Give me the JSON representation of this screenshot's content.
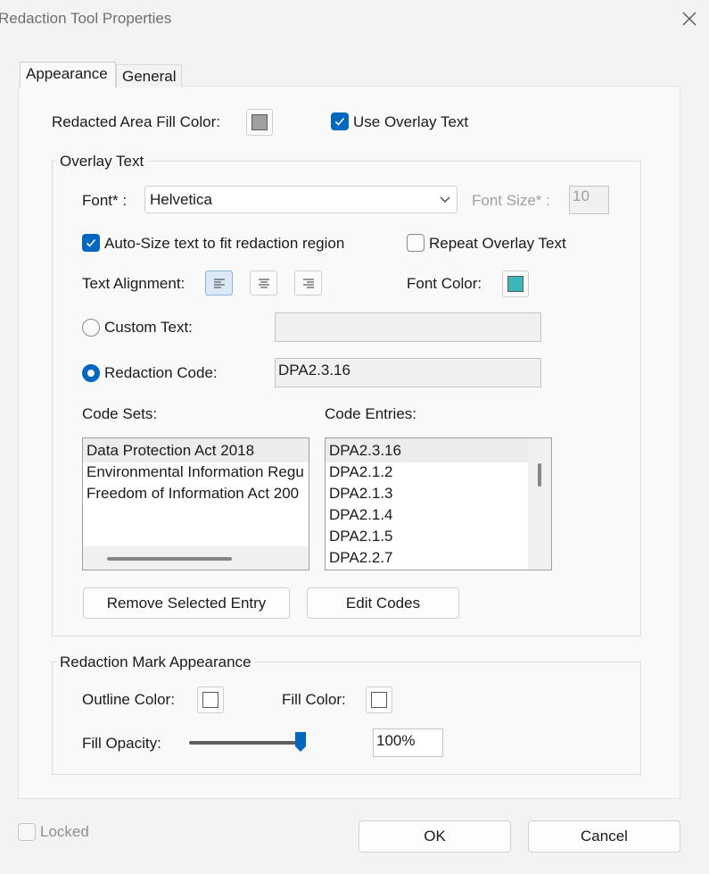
{
  "window": {
    "title": "Redaction Tool Properties"
  },
  "tabs": [
    {
      "label": "Appearance"
    },
    {
      "label": "General"
    }
  ],
  "appearance": {
    "fill_color_label": "Redacted Area Fill Color:",
    "fill_color": "#a0a0a0",
    "use_overlay_label": "Use Overlay Text",
    "use_overlay_checked": true
  },
  "overlay": {
    "group_title": "Overlay Text",
    "font_label": "Font* :",
    "font_value": "Helvetica",
    "font_size_label": "Font Size* :",
    "font_size_value": "10",
    "autosize_label": "Auto-Size text to fit redaction region",
    "autosize_checked": true,
    "repeat_label": "Repeat Overlay Text",
    "repeat_checked": false,
    "alignment_label": "Text Alignment:",
    "alignment_selected": "left",
    "font_color_label": "Font Color:",
    "font_color": "#3bb7b8",
    "custom_text_label": "Custom Text:",
    "custom_text_value": "",
    "redaction_code_label": "Redaction Code:",
    "redaction_code_value": "DPA2.3.16",
    "selected_mode": "redaction_code",
    "code_sets_label": "Code Sets:",
    "code_entries_label": "Code Entries:",
    "code_sets": [
      "Data Protection Act 2018",
      "Environmental Information Regu",
      "Freedom of Information Act 200"
    ],
    "code_entries": [
      "DPA2.3.16",
      "DPA2.1.2",
      "DPA2.1.3",
      "DPA2.1.4",
      "DPA2.1.5",
      "DPA2.2.7"
    ],
    "remove_button": "Remove Selected Entry",
    "edit_button": "Edit Codes"
  },
  "mark": {
    "group_title": "Redaction Mark Appearance",
    "outline_label": "Outline Color:",
    "fill_label": "Fill Color:",
    "opacity_label": "Fill Opacity:",
    "opacity_value": "100%",
    "opacity_fraction": 1.0
  },
  "footer": {
    "locked_label": "Locked",
    "locked_checked": false,
    "ok_label": "OK",
    "cancel_label": "Cancel"
  }
}
